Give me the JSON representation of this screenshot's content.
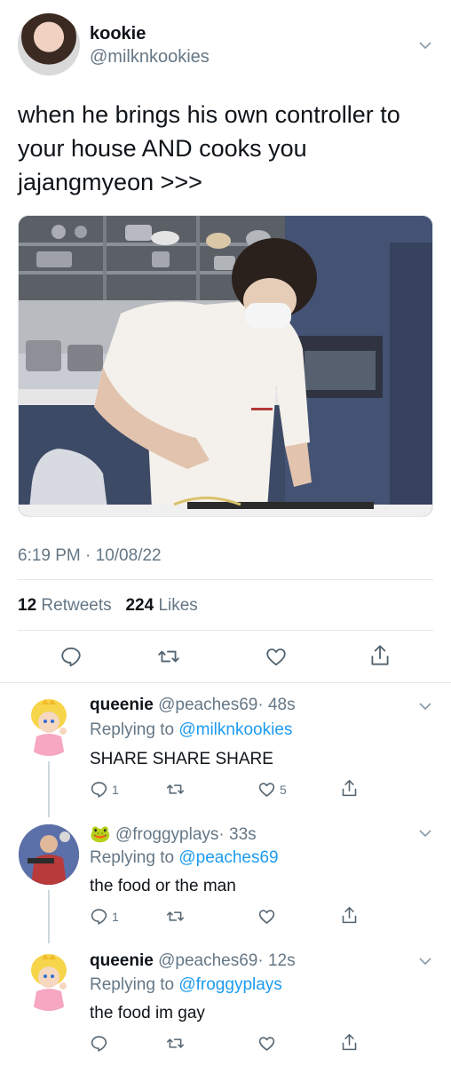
{
  "tweet": {
    "display_name": "kookie",
    "handle": "@milknkookies",
    "text_line1": "when he brings his own controller to",
    "text_line2": "your house AND cooks you",
    "text_line3": "jajangmyeon >>>",
    "timestamp": "6:19 PM · 10/08/22",
    "retweets_count": "12",
    "retweets_label": "Retweets",
    "likes_count": "224",
    "likes_label": "Likes"
  },
  "replies": [
    {
      "display_name": "queenie",
      "handle": "@peaches69",
      "time": "· 48s",
      "replying_prefix": "Replying to",
      "replying_to": "@milknkookies",
      "text": "SHARE SHARE SHARE",
      "reply_count": "1",
      "like_count": "5"
    },
    {
      "display_name": "🐸",
      "handle": "@froggyplays",
      "time": "· 33s",
      "replying_prefix": "Replying to",
      "replying_to": "@peaches69",
      "text": "the food or the man",
      "reply_count": "1",
      "like_count": ""
    },
    {
      "display_name": "queenie",
      "handle": "@peaches69",
      "time": "· 12s",
      "replying_prefix": "Replying to",
      "replying_to": "@froggyplays",
      "text": "the food im gay",
      "reply_count": "",
      "like_count": ""
    }
  ],
  "colors": {
    "link_blue": "#1d9bf0",
    "secondary_text": "#657786",
    "divider": "#e1e8ed"
  }
}
